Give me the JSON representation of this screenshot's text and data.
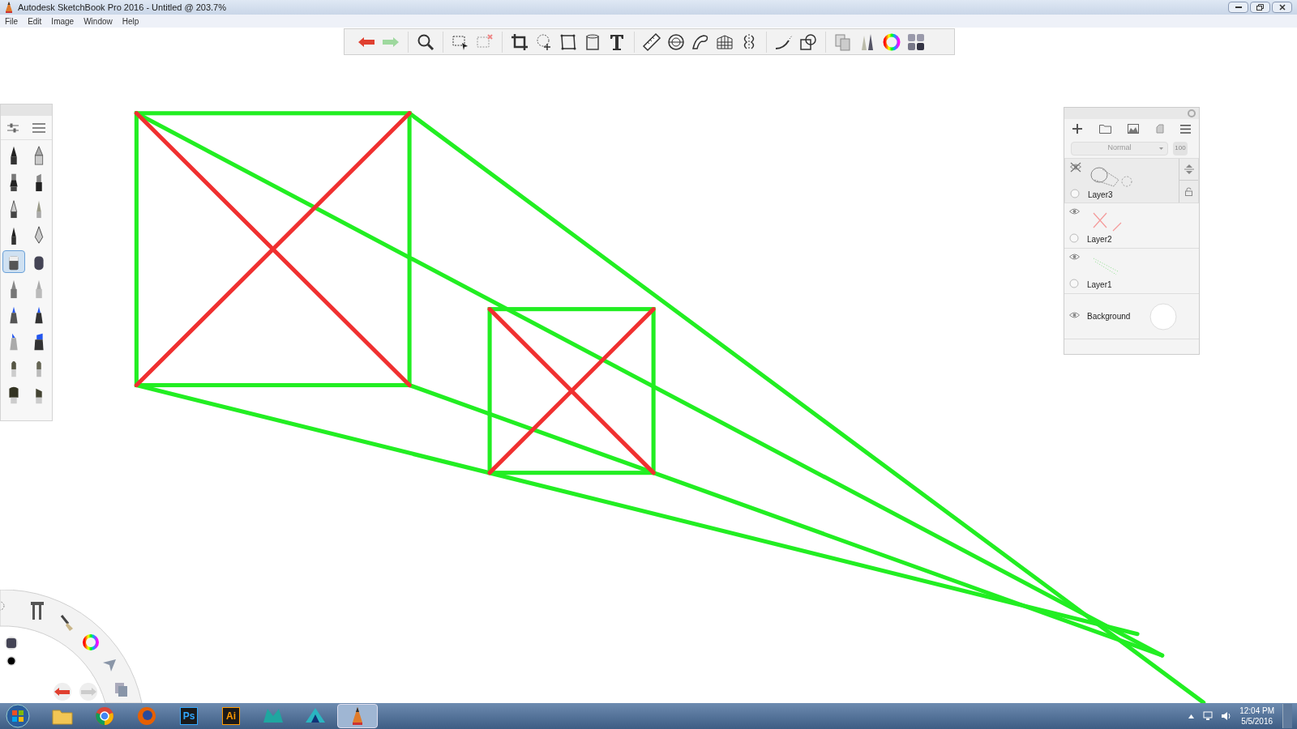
{
  "window": {
    "title": "Autodesk SketchBook Pro 2016 - Untitled @ 203.7%"
  },
  "menu": [
    "File",
    "Edit",
    "Image",
    "Window",
    "Help"
  ],
  "brushes": [
    {
      "selected": false
    },
    {
      "selected": false
    },
    {
      "selected": false
    },
    {
      "selected": false
    },
    {
      "selected": false
    },
    {
      "selected": false
    },
    {
      "selected": false
    },
    {
      "selected": false
    },
    {
      "selected": true
    },
    {
      "selected": false
    },
    {
      "selected": false
    },
    {
      "selected": false
    },
    {
      "selected": false
    },
    {
      "selected": false
    },
    {
      "selected": false
    },
    {
      "selected": false
    },
    {
      "selected": false
    },
    {
      "selected": false
    },
    {
      "selected": false
    },
    {
      "selected": false
    }
  ],
  "layers_panel": {
    "blend_mode": "Normal",
    "opacity": "100",
    "layers": [
      {
        "name": "Layer3",
        "kind": "layer",
        "visible": false,
        "selected": true
      },
      {
        "name": "Layer2",
        "kind": "layer",
        "visible": true,
        "selected": false
      },
      {
        "name": "Layer1",
        "kind": "layer",
        "visible": true,
        "selected": false
      },
      {
        "name": "Background",
        "kind": "background",
        "visible": true,
        "selected": false
      }
    ]
  },
  "taskbar": {
    "apps": [
      {
        "kind": "folder",
        "selected": false
      },
      {
        "kind": "chrome",
        "selected": false
      },
      {
        "kind": "firefox",
        "selected": false
      },
      {
        "kind": "text",
        "label": "Ps",
        "color": "#31a8ff",
        "selected": false
      },
      {
        "kind": "text",
        "label": "Ai",
        "color": "#ff9a00",
        "selected": false
      },
      {
        "kind": "maya",
        "selected": false
      },
      {
        "kind": "mudbox",
        "selected": false
      },
      {
        "kind": "sketchbook",
        "selected": true
      }
    ],
    "time": "12:04 PM",
    "date": "5/5/2016"
  }
}
